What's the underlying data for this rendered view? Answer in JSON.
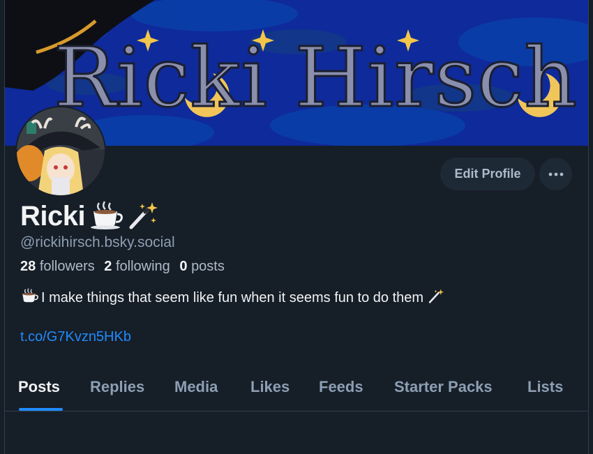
{
  "banner": {
    "title": "Ricki Hirsch"
  },
  "profile": {
    "display_name": "Ricki",
    "handle": "@rickihirsch.bsky.social",
    "followers_count": "28",
    "followers_label": "followers",
    "following_count": "2",
    "following_label": "following",
    "posts_count": "0",
    "posts_label": "posts",
    "bio": "I make things that seem like fun when it seems fun to do them",
    "link": "t.co/G7Kvzn5HKb"
  },
  "actions": {
    "edit_profile": "Edit Profile",
    "more_icon": "ellipsis-icon"
  },
  "tabs": [
    {
      "label": "Posts"
    },
    {
      "label": "Replies"
    },
    {
      "label": "Media"
    },
    {
      "label": "Likes"
    },
    {
      "label": "Feeds"
    },
    {
      "label": "Starter Packs"
    },
    {
      "label": "Lists"
    }
  ],
  "colors": {
    "accent": "#208bfe",
    "background": "#161e27",
    "banner": "#0f2a9a",
    "muted_text": "#8d9fb3"
  }
}
